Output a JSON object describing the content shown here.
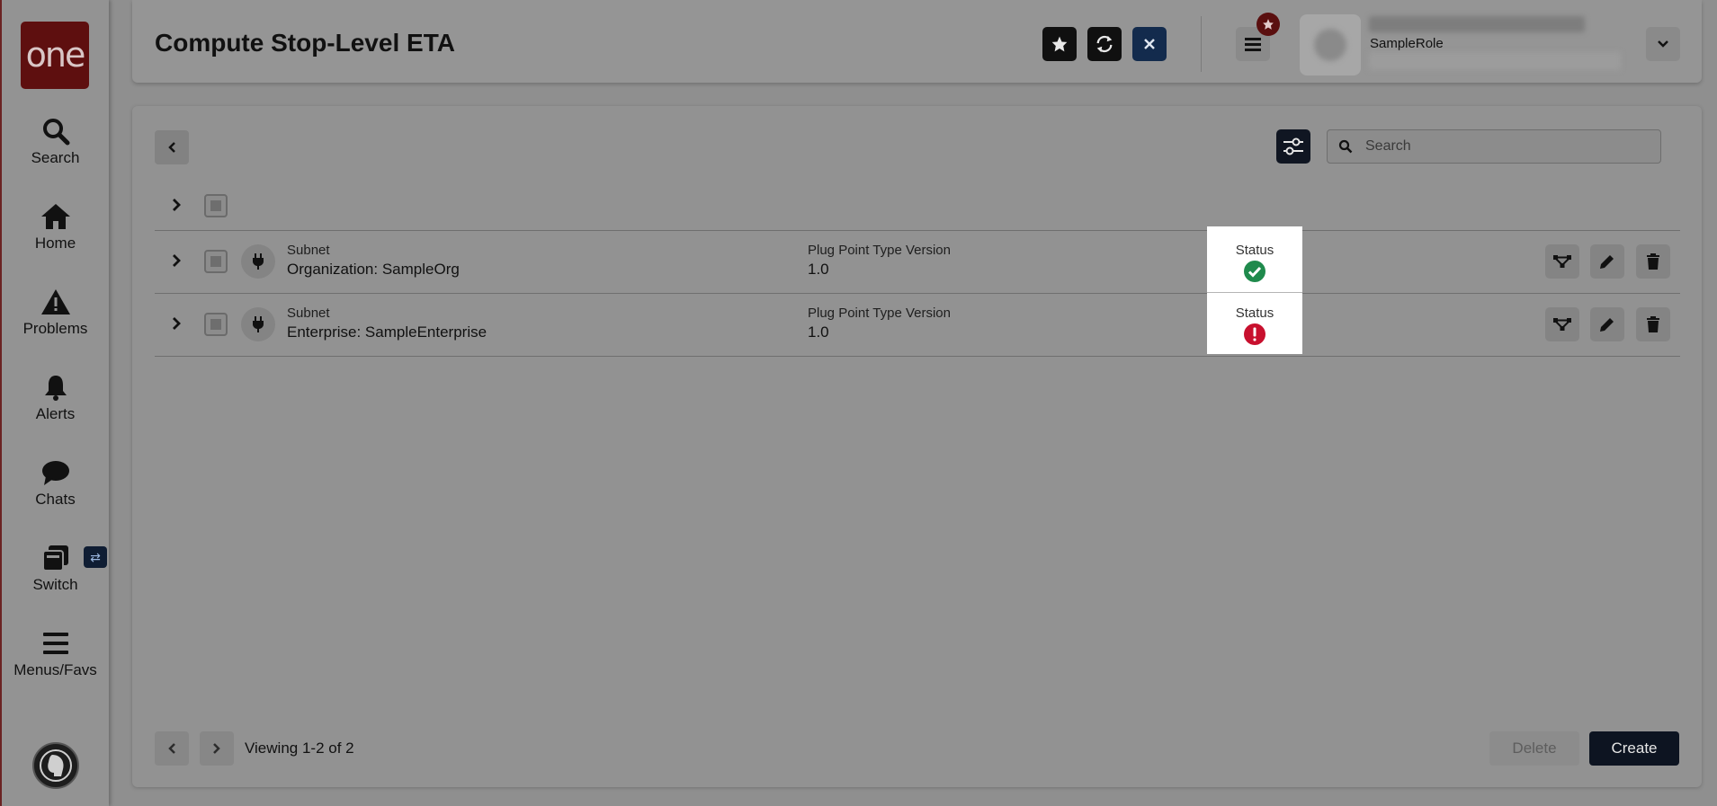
{
  "app": {
    "logo_text": "one"
  },
  "sidebar": {
    "items": [
      {
        "label": "Search",
        "icon": "search-icon"
      },
      {
        "label": "Home",
        "icon": "home-icon"
      },
      {
        "label": "Problems",
        "icon": "warning-icon"
      },
      {
        "label": "Alerts",
        "icon": "bell-icon"
      },
      {
        "label": "Chats",
        "icon": "chat-icon"
      },
      {
        "label": "Switch",
        "icon": "switch-icon"
      },
      {
        "label": "Menus/Favs",
        "icon": "hamburger-icon"
      }
    ]
  },
  "header": {
    "title": "Compute Stop-Level ETA",
    "user_role": "SampleRole"
  },
  "toolbar": {
    "search_placeholder": "Search"
  },
  "table": {
    "rows": [
      {
        "type_label": "Subnet",
        "name": "Organization: SampleOrg",
        "version_label": "Plug Point Type Version",
        "version": "1.0",
        "status_label": "Status",
        "status": "success"
      },
      {
        "type_label": "Subnet",
        "name": "Enterprise: SampleEnterprise",
        "version_label": "Plug Point Type Version",
        "version": "1.0",
        "status_label": "Status",
        "status": "error"
      }
    ]
  },
  "footer": {
    "viewing": "Viewing 1-2 of 2",
    "delete_label": "Delete",
    "create_label": "Create"
  },
  "colors": {
    "status_success": "#1f8a4c",
    "status_error": "#c8102e",
    "brand": "#5e0f0f",
    "primary_button": "#0d1421"
  }
}
